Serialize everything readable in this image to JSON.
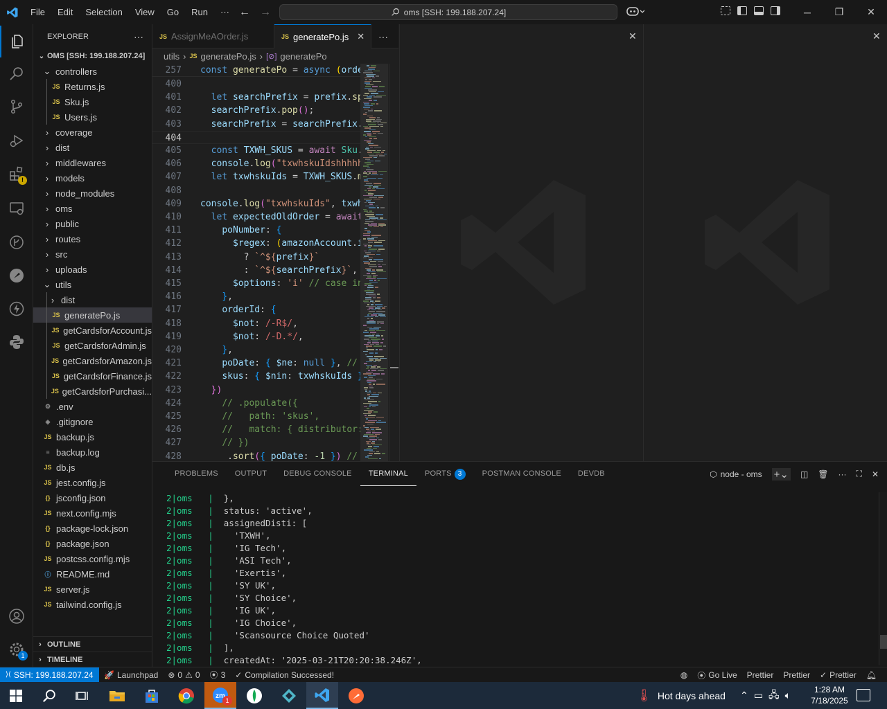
{
  "menu": [
    "File",
    "Edit",
    "Selection",
    "View",
    "Go",
    "Run",
    "···"
  ],
  "command_center": "oms [SSH: 199.188.207.24]",
  "sidebar": {
    "title": "EXPLORER",
    "more": "···",
    "root": "OMS [SSH: 199.188.207.24]",
    "items": [
      {
        "label": "controllers",
        "type": "folder-open",
        "depth": 1
      },
      {
        "label": "Returns.js",
        "type": "js",
        "depth": 2
      },
      {
        "label": "Sku.js",
        "type": "js",
        "depth": 2
      },
      {
        "label": "Users.js",
        "type": "js",
        "depth": 2
      },
      {
        "label": "coverage",
        "type": "folder",
        "depth": 1
      },
      {
        "label": "dist",
        "type": "folder",
        "depth": 1
      },
      {
        "label": "middlewares",
        "type": "folder",
        "depth": 1
      },
      {
        "label": "models",
        "type": "folder",
        "depth": 1
      },
      {
        "label": "node_modules",
        "type": "folder",
        "depth": 1
      },
      {
        "label": "oms",
        "type": "folder",
        "depth": 1
      },
      {
        "label": "public",
        "type": "folder",
        "depth": 1
      },
      {
        "label": "routes",
        "type": "folder",
        "depth": 1
      },
      {
        "label": "src",
        "type": "folder",
        "depth": 1
      },
      {
        "label": "uploads",
        "type": "folder",
        "depth": 1
      },
      {
        "label": "utils",
        "type": "folder-open",
        "depth": 1
      },
      {
        "label": "dist",
        "type": "folder",
        "depth": 2
      },
      {
        "label": "generatePo.js",
        "type": "js",
        "depth": 2
      },
      {
        "label": "getCardsforAccount.js",
        "type": "js",
        "depth": 2
      },
      {
        "label": "getCardsforAdmin.js",
        "type": "js",
        "depth": 2
      },
      {
        "label": "getCardsforAmazon.js",
        "type": "js",
        "depth": 2
      },
      {
        "label": "getCardsforFinance.js",
        "type": "js",
        "depth": 2
      },
      {
        "label": "getCardsforPurchasi...",
        "type": "js",
        "depth": 2
      },
      {
        "label": ".env",
        "type": "gear",
        "depth": 1
      },
      {
        "label": ".gitignore",
        "type": "git",
        "depth": 1
      },
      {
        "label": "backup.js",
        "type": "js",
        "depth": 1
      },
      {
        "label": "backup.log",
        "type": "log",
        "depth": 1
      },
      {
        "label": "db.js",
        "type": "js",
        "depth": 1
      },
      {
        "label": "jest.config.js",
        "type": "js",
        "depth": 1
      },
      {
        "label": "jsconfig.json",
        "type": "json",
        "depth": 1
      },
      {
        "label": "next.config.mjs",
        "type": "js",
        "depth": 1
      },
      {
        "label": "package-lock.json",
        "type": "json",
        "depth": 1
      },
      {
        "label": "package.json",
        "type": "json",
        "depth": 1
      },
      {
        "label": "postcss.config.mjs",
        "type": "js",
        "depth": 1
      },
      {
        "label": "README.md",
        "type": "info",
        "depth": 1
      },
      {
        "label": "server.js",
        "type": "js",
        "depth": 1
      },
      {
        "label": "tailwind.config.js",
        "type": "js",
        "depth": 1
      }
    ],
    "outline": "OUTLINE",
    "timeline": "TIMELINE"
  },
  "editor": {
    "tabs": [
      {
        "label": "AssignMeAOrder.js",
        "active": false
      },
      {
        "label": "generatePo.js",
        "active": true
      }
    ],
    "tabs_more": "···",
    "breadcrumb": [
      "utils",
      "generatePo.js",
      "generatePo"
    ],
    "sticky": {
      "ln": "257",
      "code": "const generatePo = async (orde"
    },
    "lines": [
      {
        "ln": "400",
        "html": ""
      },
      {
        "ln": "401",
        "html": "  <span class='kw'>let</span> <span class='var'>searchPrefix</span> = <span class='var'>prefix</span>.<span class='fn'>sp</span>"
      },
      {
        "ln": "402",
        "html": "  <span class='var'>searchPrefix</span>.<span class='fn'>pop</span><span class='br2'>()</span>;"
      },
      {
        "ln": "403",
        "html": "  <span class='var'>searchPrefix</span> = <span class='var'>searchPrefix</span>."
      },
      {
        "ln": "404",
        "html": "",
        "current": true
      },
      {
        "ln": "405",
        "html": "  <span class='kw'>const</span> <span class='var'>TXWH_SKUS</span> = <span class='ctl'>await</span> <span class='cls'>Sku</span>."
      },
      {
        "ln": "406",
        "html": "  <span class='var'>console</span>.<span class='fn'>log</span><span class='br2'>(</span><span class='str'>\"txwhskuIdshhhhh</span>"
      },
      {
        "ln": "407",
        "html": "  <span class='kw'>let</span> <span class='var'>txwhskuIds</span> = <span class='var'>TXWH_SKUS</span>.<span class='fn'>m</span>"
      },
      {
        "ln": "408",
        "html": ""
      },
      {
        "ln": "409",
        "html": "<span class='var'>console</span>.<span class='fn'>log</span><span class='br2'>(</span><span class='str'>\"txwhskuIds\"</span>, <span class='var'>txwh</span>"
      },
      {
        "ln": "410",
        "html": "  <span class='kw'>let</span> <span class='var'>expectedOldOrder</span> = <span class='ctl'>await</span>"
      },
      {
        "ln": "411",
        "html": "    <span class='var'>poNumber</span>: <span class='br3'>{</span>"
      },
      {
        "ln": "412",
        "html": "      <span class='var'>$regex</span>: <span class='br1'>(</span><span class='var'>amazonAccount</span>.<span class='var'>i</span>"
      },
      {
        "ln": "413",
        "html": "        ? <span class='str'>`^${</span><span class='var'>prefix</span><span class='str'>}`</span>"
      },
      {
        "ln": "414",
        "html": "        : <span class='str'>`^${</span><span class='var'>searchPrefix</span><span class='str'>}`</span>,"
      },
      {
        "ln": "415",
        "html": "      <span class='var'>$options</span>: <span class='str'>'i'</span> <span class='cm'>// case in</span>"
      },
      {
        "ln": "416",
        "html": "    <span class='br3'>}</span>,"
      },
      {
        "ln": "417",
        "html": "    <span class='var'>orderId</span>: <span class='br3'>{</span>"
      },
      {
        "ln": "418",
        "html": "      <span class='var'>$not</span>: <span class='rx'>/-R$/</span>,"
      },
      {
        "ln": "419",
        "html": "      <span class='var'>$not</span>: <span class='rx'>/-D.*/</span>,"
      },
      {
        "ln": "420",
        "html": "    <span class='br3'>}</span>,"
      },
      {
        "ln": "421",
        "html": "    <span class='var'>poDate</span>: <span class='br3'>{</span> <span class='var'>$ne</span>: <span class='kw'>null</span> <span class='br3'>}</span>, <span class='cm'>//</span>"
      },
      {
        "ln": "422",
        "html": "    <span class='var'>skus</span>: <span class='br3'>{</span> <span class='var'>$nin</span>: <span class='var'>txwhskuIds</span> <span class='br3'>}</span>"
      },
      {
        "ln": "423",
        "html": "  <span class='br2'>})</span>"
      },
      {
        "ln": "424",
        "html": "    <span class='cm'>// .populate({</span>"
      },
      {
        "ln": "425",
        "html": "    <span class='cm'>//   path: 'skus',</span>"
      },
      {
        "ln": "426",
        "html": "    <span class='cm'>//   match: { distributor:</span>"
      },
      {
        "ln": "427",
        "html": "    <span class='cm'>// })</span>"
      },
      {
        "ln": "428",
        "html": "     .<span class='fn'>sort</span><span class='br2'>(</span><span class='br3'>{</span> <span class='var'>poDate</span>: <span class='num'>-1</span> <span class='br3'>}</span><span class='br2'>)</span> <span class='cm'>// S</span>"
      }
    ]
  },
  "panel": {
    "tabs": [
      {
        "label": "PROBLEMS"
      },
      {
        "label": "OUTPUT"
      },
      {
        "label": "DEBUG CONSOLE"
      },
      {
        "label": "TERMINAL",
        "active": true
      },
      {
        "label": "PORTS",
        "badge": "3"
      },
      {
        "label": "POSTMAN CONSOLE"
      },
      {
        "label": "DEVDB"
      }
    ],
    "terminal_name": "node - oms",
    "terminal_prefix": "2|oms   |",
    "terminal_lines": [
      "  },",
      "  status: 'active',",
      "  assignedDisti: [",
      "    'TXWH',",
      "    'IG Tech',",
      "    'ASI Tech',",
      "    'Exertis',",
      "    'SY UK',",
      "    'SY Choice',",
      "    'IG UK',",
      "    'IG Choice',",
      "    'Scansource Choice Quoted'",
      "  ],",
      "  createdAt: '2025-03-21T20:20:38.246Z',"
    ]
  },
  "statusbar": {
    "remote": "SSH: 199.188.207.24",
    "launchpad": "Launchpad",
    "errors": "0",
    "warnings": "0",
    "ports": "3",
    "compile": "Compilation Successed!",
    "golive": "Go Live",
    "prettier1": "Prettier",
    "prettier2": "Prettier",
    "prettier3": "Prettier"
  },
  "taskbar": {
    "weather": "Hot days ahead",
    "time": "1:28 AM",
    "date": "7/18/2025",
    "zoom_badge": "1"
  },
  "activity_badges": {
    "settings": "1"
  }
}
